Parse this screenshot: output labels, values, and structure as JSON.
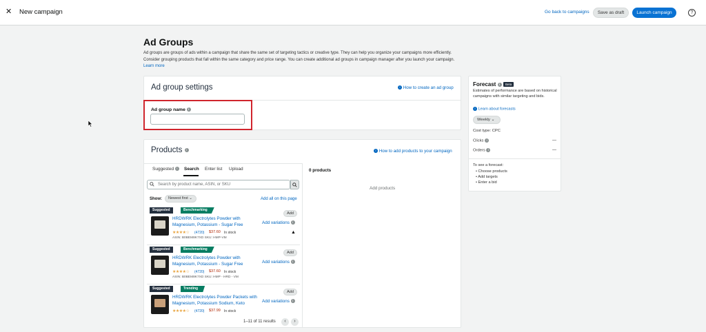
{
  "topbar": {
    "close_glyph": "✕",
    "title": "New campaign",
    "go_back": "Go back to campaigns",
    "save_draft": "Save as draft",
    "launch": "Launch campaign",
    "help_glyph": "?"
  },
  "section": {
    "title": "Ad Groups",
    "description": "Ad groups are groups of ads within a campaign that share the same set of targeting tactics or creative type. They can help you organize your campaigns more efficiently. Consider grouping products that fall within the same category and price range. You can create additional ad groups in campaign manager after you launch your campaign.",
    "learn_more": "Learn more"
  },
  "ad_group_settings": {
    "title": "Ad group settings",
    "help_link": "How to create an ad group",
    "name_label": "Ad group name",
    "name_value": "",
    "name_placeholder": ""
  },
  "products": {
    "title": "Products",
    "help_link": "How to add products to your campaign",
    "tabs": [
      {
        "label": "Suggested"
      },
      {
        "label": "Search"
      },
      {
        "label": "Enter list"
      },
      {
        "label": "Upload"
      }
    ],
    "active_tab": "Search",
    "search_placeholder": "Search by product name, ASIN, or SKU",
    "show_label": "Show:",
    "sort_value": "Newest first",
    "add_all": "Add all on this page",
    "items": [
      {
        "badge1": "Suggested",
        "badge2": "Benchmarking",
        "title": "HRDWRK Electrolytes Powder with Magnesium, Potassium - Sugar Free",
        "stars": "★★★★☆",
        "rating_count": "(4720)",
        "price": "$37.60",
        "stock": "In stock",
        "asin": "ASIN: B0BEM8K7XD   SKU: HMP-VM",
        "add_variations": "Add variations",
        "add": "Add",
        "warning": "▲"
      },
      {
        "badge1": "Suggested",
        "badge2": "Benchmarking",
        "title": "HRDWRK Electrolytes Powder with Magnesium, Potassium - Sugar Free",
        "stars": "★★★★☆",
        "rating_count": "(4720)",
        "price": "$37.60",
        "stock": "In stock",
        "asin": "ASIN: B0BEM8K7XD   SKU: HMP - HRD - VM",
        "add_variations": "Add variations",
        "add": "Add"
      },
      {
        "badge1": "Suggested",
        "badge2": "Trending",
        "title": "HRDWRK Electrolytes Powder Packets with Magnesium, Potassium Sodium, Keto",
        "stars": "★★★★☆",
        "rating_count": "(4720)",
        "price": "$37.99",
        "stock": "In stock",
        "add_variations": "Add variations",
        "add": "Add"
      }
    ],
    "pager_text": "1–11 of 11 results",
    "prev_glyph": "‹",
    "next_glyph": "›",
    "selected_count": "0 products",
    "empty_text": "Add products"
  },
  "forecast": {
    "title": "Forecast",
    "beta": "Beta",
    "description": "Estimates of performance are based on historical campaigns with similar targeting and bids.",
    "learn_link": "Learn about forecasts",
    "period": "Weekly",
    "cost_type": "Cost type: CPC",
    "clicks_label": "Clicks",
    "clicks_value": "—",
    "orders_label": "Orders",
    "orders_value": "—",
    "see_text": "To see a forecast:",
    "steps": [
      "Choose products",
      "Add targets",
      "Enter a bid"
    ]
  },
  "colors": {
    "accent": "#0972d3",
    "link": "#0066c0",
    "highlight_border": "#d0242c",
    "badge_dark": "#232f3e",
    "badge_green": "#067d62"
  }
}
